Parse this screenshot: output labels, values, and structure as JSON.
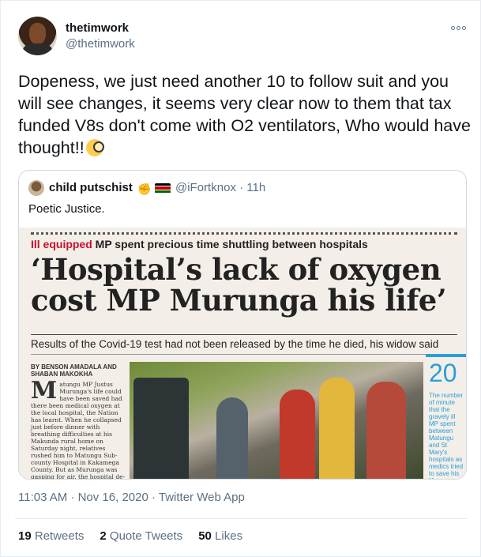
{
  "author": {
    "name": "thetimwork",
    "handle": "@thetimwork"
  },
  "tweet": {
    "text": "Dopeness, we just need another 10 to follow suit and you will see changes, it seems very clear now to them that tax funded V8s don't come with O2 ventilators, Who would have thought!!",
    "emoji": "face-with-monocle"
  },
  "quoted": {
    "name": "child putschist",
    "handle": "@iFortknox",
    "time": "11h",
    "text": "Poetic Justice.",
    "flag_colors": [
      "#000000",
      "#ffffff",
      "#bb0000",
      "#ffffff",
      "#006600"
    ]
  },
  "newspaper": {
    "kicker_red": "Ill equipped",
    "kicker_rest": "MP spent precious time shuttling between hospitals",
    "headline": "‘Hospital’s lack of oxygen cost MP Murunga his life’",
    "subhead": "Results of the Covid-19 test had not been released by the time he died, his widow said",
    "byline": "BY BENSON AMADALA AND SHABAN MAKOKHA",
    "dropcap": "M",
    "article": "atungu MP Justus Murunga's life could have been saved had there been medical oxygen at the local hospital, the Nation has learnt. When he collapsed just before dinner with breathing difficulties at his Makunda rural home on Saturday night, relatives rushed him to Matungu Sub-county Hospital in Kakamega County. But as Murunga was gasping for air, the hospital de-",
    "sidebar_number": "20",
    "sidebar_text": "The number of minute that the gravely ill MP spent between Matungu and St Mary's hospitals as medics tried to save his life."
  },
  "meta": {
    "timestamp": "11:03 AM · Nov 16, 2020 · Twitter Web App"
  },
  "stats": {
    "retweets_count": "19",
    "retweets_label": "Retweets",
    "quotes_count": "2",
    "quotes_label": "Quote Tweets",
    "likes_count": "50",
    "likes_label": "Likes"
  }
}
